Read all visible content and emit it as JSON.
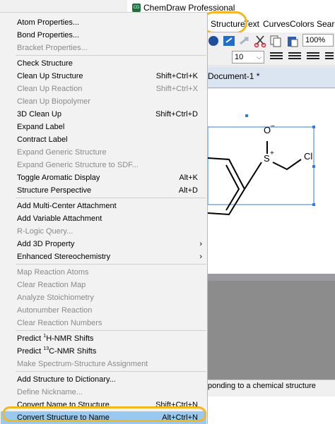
{
  "window": {
    "app_title": "ChemDraw Professional",
    "app_icon_glyph": "CD"
  },
  "menubar": {
    "items": [
      "Structure",
      "Text",
      "Curves",
      "Colors",
      "Search"
    ],
    "active": "Structure"
  },
  "toolbar": {
    "font_size_value": "10",
    "zoom_value": "100%"
  },
  "document": {
    "tab_title": "Document-1 *",
    "molecule": {
      "atoms": [
        "O",
        "S",
        "Cl"
      ],
      "o_charge": "−",
      "s_charge": "+"
    }
  },
  "status_bar": {
    "text": "ponding to a chemical structure"
  },
  "structure_menu": {
    "groups": [
      [
        {
          "label": "Atom Properties...",
          "enabled": true
        },
        {
          "label": "Bond Properties...",
          "enabled": true
        },
        {
          "label": "Bracket Properties...",
          "enabled": false
        }
      ],
      [
        {
          "label": "Check Structure",
          "enabled": true
        },
        {
          "label": "Clean Up Structure",
          "shortcut": "Shift+Ctrl+K",
          "enabled": true
        },
        {
          "label": "Clean Up Reaction",
          "shortcut": "Shift+Ctrl+X",
          "enabled": false
        },
        {
          "label": "Clean Up Biopolymer",
          "enabled": false
        },
        {
          "label": "3D Clean Up",
          "shortcut": "Shift+Ctrl+D",
          "enabled": true
        },
        {
          "label": "Expand Label",
          "enabled": true
        },
        {
          "label": "Contract Label",
          "enabled": true
        },
        {
          "label": "Expand Generic Structure",
          "enabled": false
        },
        {
          "label": "Expand Generic Structure to SDF...",
          "enabled": false
        },
        {
          "label": "Toggle Aromatic Display",
          "shortcut": "Alt+K",
          "enabled": true
        },
        {
          "label": "Structure Perspective",
          "shortcut": "Alt+D",
          "enabled": true
        }
      ],
      [
        {
          "label": "Add Multi-Center Attachment",
          "enabled": true
        },
        {
          "label": "Add Variable Attachment",
          "enabled": true
        },
        {
          "label": "R-Logic Query...",
          "enabled": false
        },
        {
          "label": "Add 3D Property",
          "enabled": true,
          "submenu": true
        },
        {
          "label": "Enhanced Stereochemistry",
          "enabled": true,
          "submenu": true
        }
      ],
      [
        {
          "label": "Map Reaction Atoms",
          "enabled": false
        },
        {
          "label": "Clear Reaction Map",
          "enabled": false
        },
        {
          "label": "Analyze Stoichiometry",
          "enabled": false
        },
        {
          "label": "Autonumber Reaction",
          "enabled": false
        },
        {
          "label": "Clear Reaction Numbers",
          "enabled": false
        }
      ],
      [
        {
          "label_pre": "Predict ",
          "label_sup": "1",
          "label_post": "H-NMR Shifts",
          "enabled": true
        },
        {
          "label_pre": "Predict ",
          "label_sup": "13",
          "label_post": "C-NMR Shifts",
          "enabled": true
        },
        {
          "label": "Make Spectrum-Structure Assignment",
          "enabled": false
        }
      ],
      [
        {
          "label": "Add Structure to Dictionary...",
          "enabled": true
        },
        {
          "label": "Define Nickname...",
          "enabled": false
        },
        {
          "label": "Convert Name to Structure",
          "shortcut": "Shift+Ctrl+N",
          "enabled": true
        },
        {
          "label": "Convert Structure to Name",
          "shortcut": "Alt+Ctrl+N",
          "enabled": true,
          "selected": true
        }
      ]
    ]
  },
  "colors": {
    "highlight_ring": "#f2b820",
    "selected_item_bg": "#99c9ef",
    "selection_box": "#3a7bd5",
    "disabled_text": "#8a8a8a"
  }
}
